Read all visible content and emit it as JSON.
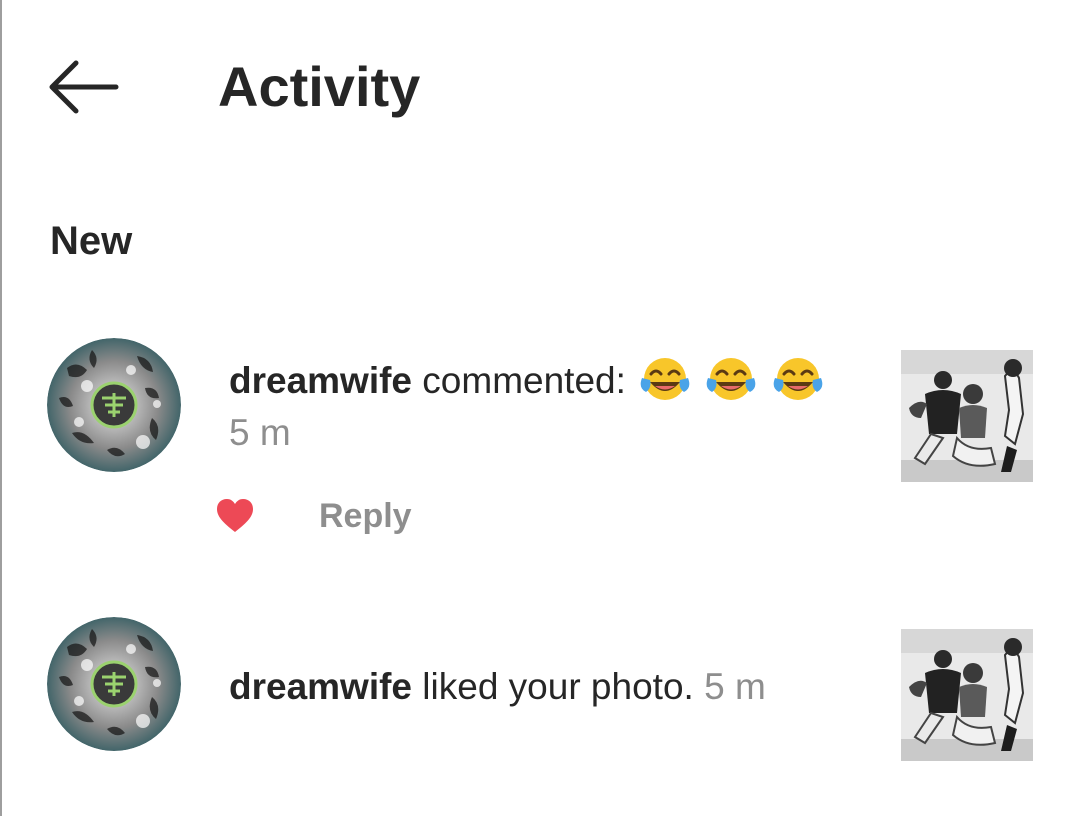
{
  "header": {
    "title": "Activity",
    "back_icon": "arrow-left-icon"
  },
  "section": {
    "title": "New"
  },
  "notifications": [
    {
      "username": "dreamwife",
      "action": "commented:",
      "emojis": [
        "face-with-tears-of-joy",
        "face-with-tears-of-joy",
        "face-with-tears-of-joy"
      ],
      "time": "5 m",
      "like_icon": "heart-icon",
      "like_color": "#ed4956",
      "reply_label": "Reply"
    },
    {
      "username": "dreamwife",
      "action": "liked your photo.",
      "time": "5 m"
    }
  ]
}
